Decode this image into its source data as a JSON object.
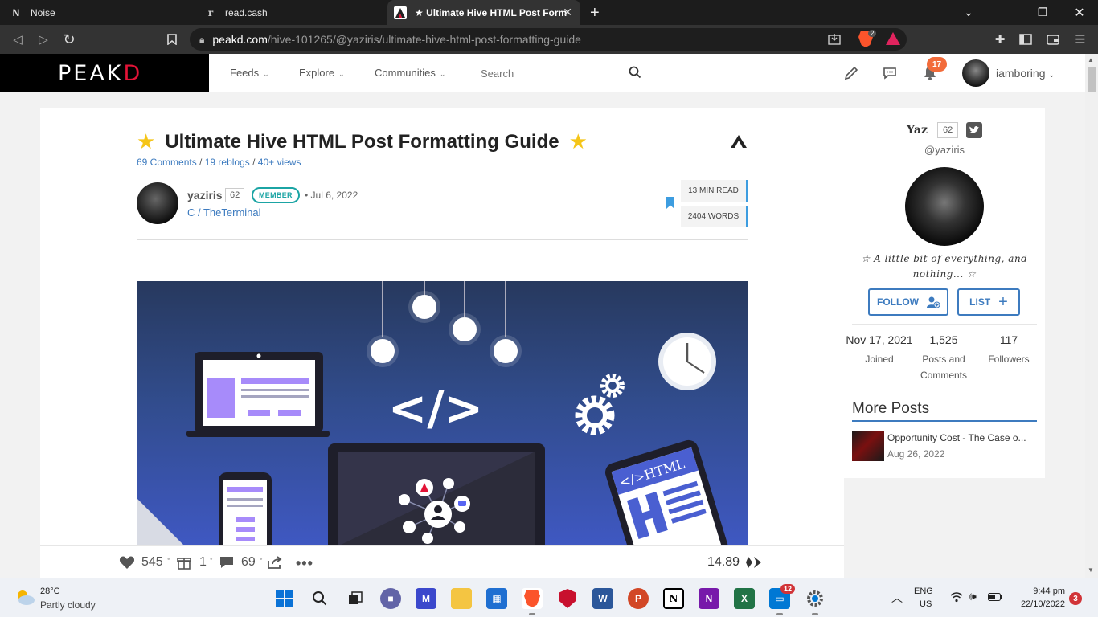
{
  "browser": {
    "tabs": [
      {
        "title": "Noise",
        "icon": "N"
      },
      {
        "title": "read.cash",
        "icon": "r"
      },
      {
        "title": "★ Ultimate Hive HTML Post Form",
        "icon": "peakd-logo"
      }
    ],
    "url_host": "peakd.com",
    "url_path": "/hive-101265/@yaziris/ultimate-hive-html-post-formatting-guide",
    "brave_shield_count": "2"
  },
  "header": {
    "logo_main": "PEAK",
    "logo_d": "D",
    "nav": [
      "Feeds",
      "Explore",
      "Communities"
    ],
    "search_placeholder": "Search",
    "notification_count": "17",
    "username": "iamboring"
  },
  "post": {
    "title": "Ultimate Hive HTML Post Formatting Guide",
    "comments": "69 Comments",
    "reblogs": "19 reblogs",
    "views": "40+ views",
    "author": "yaziris",
    "author_rep": "62",
    "member_badge": "MEMBER",
    "date": "• Jul 6, 2022",
    "community": "C / TheTerminal",
    "read_time": "13 MIN READ",
    "word_count": "2404 WORDS",
    "hero_code_text": "</>",
    "hero_html_text": "</>HTML"
  },
  "actions": {
    "votes": "545",
    "gifts": "1",
    "comments": "69",
    "payout": "14.89"
  },
  "sidebar": {
    "name": "Yaz",
    "rep": "62",
    "handle": "@yaziris",
    "bio": "☆ A little bit of everything, and nothing... ☆",
    "follow_label": "FOLLOW",
    "list_label": "LIST",
    "stats": [
      {
        "value": "Nov 17, 2021",
        "label": "Joined"
      },
      {
        "value": "1,525",
        "label": "Posts and Comments"
      },
      {
        "value": "117",
        "label": "Followers"
      }
    ],
    "more_posts_title": "More Posts",
    "more_posts": [
      {
        "title": "Opportunity Cost - The Case o...",
        "date": "Aug 26, 2022"
      }
    ]
  },
  "taskbar": {
    "temperature": "28°C",
    "weather": "Partly cloudy",
    "lang_top": "ENG",
    "lang_bottom": "US",
    "time": "9:44 pm",
    "date": "22/10/2022",
    "teams_badge": "12",
    "notif_badge": "3"
  },
  "colors": {
    "peakd_red": "#e31337",
    "link_blue": "#3d7bbf",
    "member_teal": "#1ba4a4",
    "notif_orange": "#f26b3a"
  }
}
